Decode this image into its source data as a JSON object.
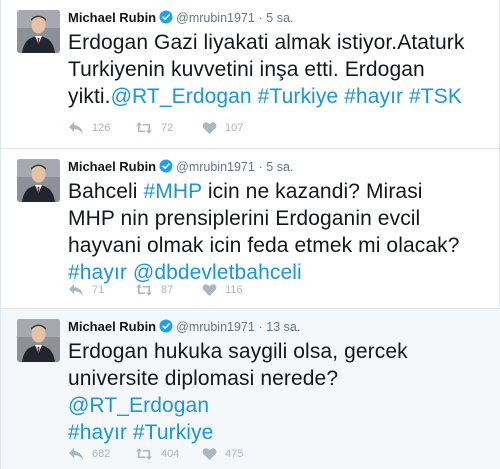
{
  "tweets": [
    {
      "author": "Michael Rubin",
      "handle": "@mrubin1971",
      "separator": "·",
      "time": "5 sa.",
      "lines": [
        [
          {
            "text": "Erdogan Gazi liyakati almak istiyor.Ataturk"
          }
        ],
        [
          {
            "text": "Turkiyenin kuvvetini inşa etti. Erdogan"
          }
        ],
        [
          {
            "text": "yikti."
          },
          {
            "text": "@RT_Erdogan #Turkiye #hayır #TSK",
            "link": true
          }
        ]
      ],
      "replies": "126",
      "retweets": "72",
      "likes": "107"
    },
    {
      "author": "Michael Rubin",
      "handle": "@mrubin1971",
      "separator": "·",
      "time": "5 sa.",
      "lines": [
        [
          {
            "text": "Bahceli "
          },
          {
            "text": "#MHP",
            "link": true
          },
          {
            "text": " icin ne kazandi? Mirasi"
          }
        ],
        [
          {
            "text": "MHP nin prensiplerini Erdoganin evcil"
          }
        ],
        [
          {
            "text": "hayvani olmak icin feda etmek mi olacak?"
          }
        ],
        [
          {
            "text": "#hayır @dbdevletbahceli",
            "link": true
          }
        ]
      ],
      "replies": "71",
      "retweets": "87",
      "likes": "116"
    },
    {
      "author": "Michael Rubin",
      "handle": "@mrubin1971",
      "separator": "·",
      "time": "13 sa.",
      "lines": [
        [
          {
            "text": "Erdogan hukuka saygili olsa, gercek"
          }
        ],
        [
          {
            "text": "universite diplomasi nerede?"
          }
        ],
        [
          {
            "text": "@RT_Erdogan",
            "link": true
          }
        ],
        [
          {
            "text": "#hayır #Turkiye",
            "link": true
          }
        ]
      ],
      "replies": "682",
      "retweets": "404",
      "likes": "475"
    }
  ],
  "icons": {
    "avatar": "avatar-photo",
    "verified": "verified-badge-icon",
    "reply": "reply-icon",
    "retweet": "retweet-icon",
    "like": "heart-icon"
  },
  "colors": {
    "link": "#1b95e0",
    "verified": "#1da1f2",
    "muted": "#657786",
    "action": "#aab8c2"
  }
}
